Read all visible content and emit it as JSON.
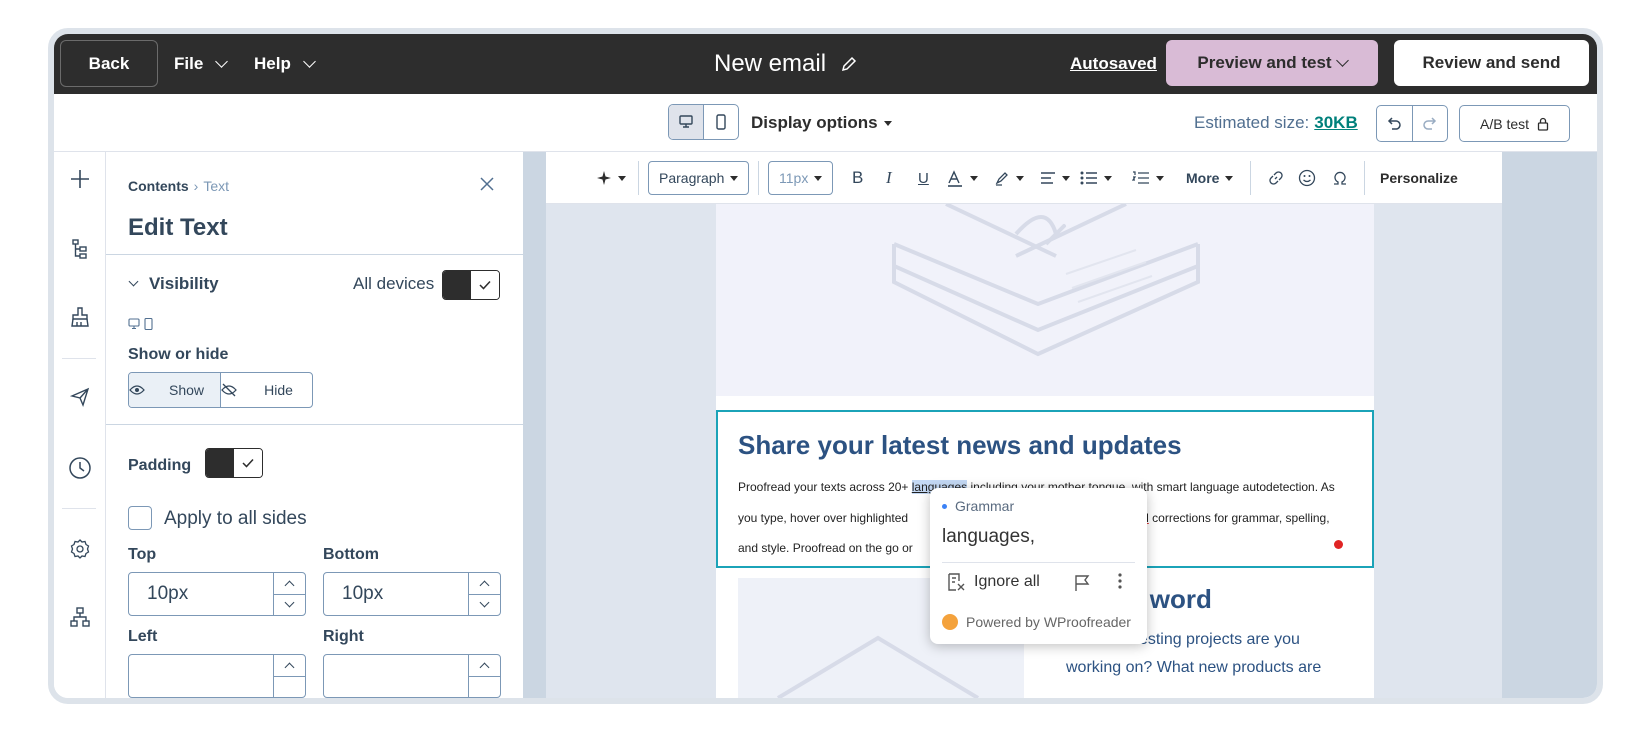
{
  "topbar": {
    "back": "Back",
    "file": "File",
    "help": "Help",
    "title": "New email",
    "autosaved": "Autosaved",
    "preview": "Preview and test",
    "review": "Review and send"
  },
  "subbar": {
    "display_options": "Display options",
    "estimated_label": "Estimated size:",
    "estimated_value": "30KB",
    "ab_test": "A/B test"
  },
  "panel": {
    "breadcrumb_root": "Contents",
    "breadcrumb_sep": "›",
    "breadcrumb_current": "Text",
    "title": "Edit Text",
    "visibility": "Visibility",
    "all_devices": "All devices",
    "show_or_hide": "Show or hide",
    "show": "Show",
    "hide": "Hide",
    "padding": "Padding",
    "apply_all_sides": "Apply to all sides",
    "top_label": "Top",
    "top_value": "10px",
    "bottom_label": "Bottom",
    "bottom_value": "10px",
    "left_label": "Left",
    "right_label": "Right"
  },
  "toolbar": {
    "paragraph": "Paragraph",
    "font_size": "11px",
    "bold": "B",
    "italic": "I",
    "underline": "U",
    "more": "More",
    "personalize": "Personalize"
  },
  "email": {
    "heading": "Share your latest news and updates",
    "p1": "Proofread your texts across 20+ ",
    "p_hl": "languages",
    "p2": " including your ",
    "p_mt": "mother tongue",
    "p3": ", with smart language autodetection. As",
    "p4": "you type, hover over highlighted",
    "p5": "ugested",
    "p6": " corrections for grammar, spelling,",
    "p7": "and style. Proofread on the go or",
    "sec2_title": "ad the word",
    "sec2_text1": "What interesting projects are you",
    "sec2_text2": "working on? What new products are"
  },
  "popup": {
    "category": "Grammar",
    "suggestion": "languages,",
    "ignore_all": "Ignore all",
    "powered": "Powered by WProofreader"
  },
  "colors": {
    "topbar": "#2d2d2d",
    "preview_button": "#d9bbd6",
    "accent_teal": "#00807b",
    "selection_border": "#1ba3b8",
    "heading_blue": "#2c5282"
  }
}
